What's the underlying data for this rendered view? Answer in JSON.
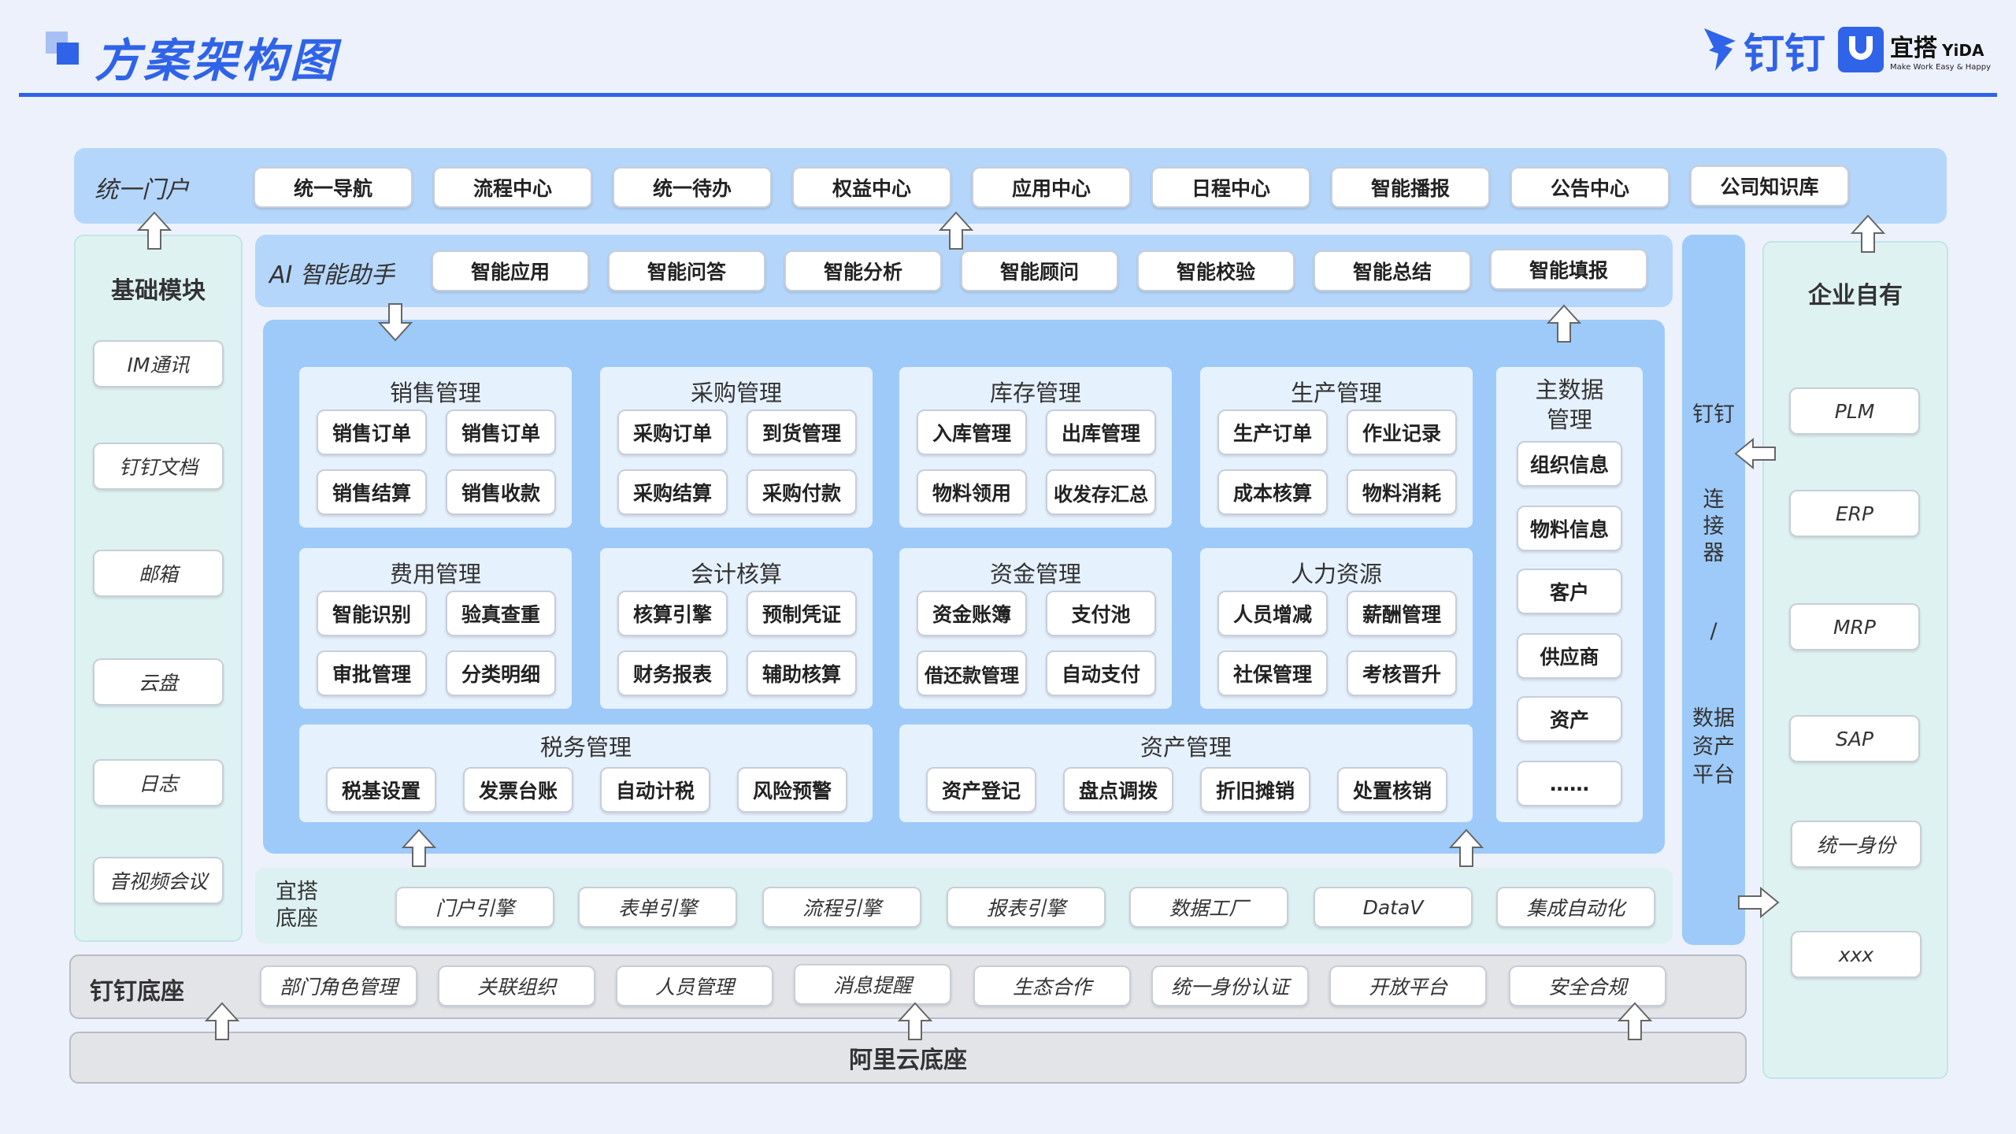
{
  "header": {
    "title": "方案架构图",
    "brand_dingtalk": "钉钉",
    "brand_yida": "宜搭",
    "brand_yida_en": "YiDA",
    "brand_yida_slogan": "Make Work Easy & Happy"
  },
  "portal": {
    "label": "统一门户",
    "items": [
      "统一导航",
      "流程中心",
      "统一待办",
      "权益中心",
      "应用中心",
      "日程中心",
      "智能播报",
      "公告中心",
      "公司知识库"
    ]
  },
  "base_modules": {
    "label": "基础模块",
    "items": [
      "IM通讯",
      "钉钉文档",
      "邮箱",
      "云盘",
      "日志",
      "音视频会议"
    ]
  },
  "ai": {
    "label": "AI 智能助手",
    "items": [
      "智能应用",
      "智能问答",
      "智能分析",
      "智能顾问",
      "智能校验",
      "智能总结",
      "智能填报"
    ]
  },
  "modules": {
    "sales": {
      "title": "销售管理",
      "items": [
        "销售订单",
        "销售订单",
        "销售结算",
        "销售收款"
      ]
    },
    "purchase": {
      "title": "采购管理",
      "items": [
        "采购订单",
        "到货管理",
        "采购结算",
        "采购付款"
      ]
    },
    "inventory": {
      "title": "库存管理",
      "items": [
        "入库管理",
        "出库管理",
        "物料领用",
        "收发存汇总"
      ]
    },
    "production": {
      "title": "生产管理",
      "items": [
        "生产订单",
        "作业记录",
        "成本核算",
        "物料消耗"
      ]
    },
    "expense": {
      "title": "费用管理",
      "items": [
        "智能识别",
        "验真查重",
        "审批管理",
        "分类明细"
      ]
    },
    "accounting": {
      "title": "会计核算",
      "items": [
        "核算引擎",
        "预制凭证",
        "财务报表",
        "辅助核算"
      ]
    },
    "funds": {
      "title": "资金管理",
      "items": [
        "资金账簿",
        "支付池",
        "借还款管理",
        "自动支付"
      ]
    },
    "hr": {
      "title": "人力资源",
      "items": [
        "人员增减",
        "薪酬管理",
        "社保管理",
        "考核晋升"
      ]
    },
    "tax": {
      "title": "税务管理",
      "items": [
        "税基设置",
        "发票台账",
        "自动计税",
        "风险预警"
      ]
    },
    "assets": {
      "title": "资产管理",
      "items": [
        "资产登记",
        "盘点调拨",
        "折旧摊销",
        "处置核销"
      ]
    },
    "master": {
      "title_line1": "主数据",
      "title_line2": "管理",
      "items": [
        "组织信息",
        "物料信息",
        "客户",
        "供应商",
        "资产",
        "……"
      ]
    }
  },
  "yida_base": {
    "label_line1": "宜搭",
    "label_line2": "底座",
    "items": [
      "门户引擎",
      "表单引擎",
      "流程引擎",
      "报表引擎",
      "数据工厂",
      "DataV",
      "集成自动化"
    ]
  },
  "connector": {
    "line1": "钉钉",
    "line2": "连",
    "line3": "接",
    "line4": "器",
    "sep": "/",
    "line5": "数据",
    "line6": "资产",
    "line7": "平台"
  },
  "enterprise": {
    "label": "企业自有",
    "items": [
      "PLM",
      "ERP",
      "MRP",
      "SAP",
      "统一身份",
      "xxx"
    ]
  },
  "dingtalk_base": {
    "label": "钉钉底座",
    "items": [
      "部门角色管理",
      "关联组织",
      "人员管理",
      "消息提醒",
      "生态合作",
      "统一身份认证",
      "开放平台",
      "安全合规"
    ]
  },
  "aliyun": {
    "label": "阿里云底座"
  },
  "colors": {
    "accent": "#2f63e8",
    "panel_blue": "#b5d6fb",
    "panel_mint": "#dff2f2"
  }
}
